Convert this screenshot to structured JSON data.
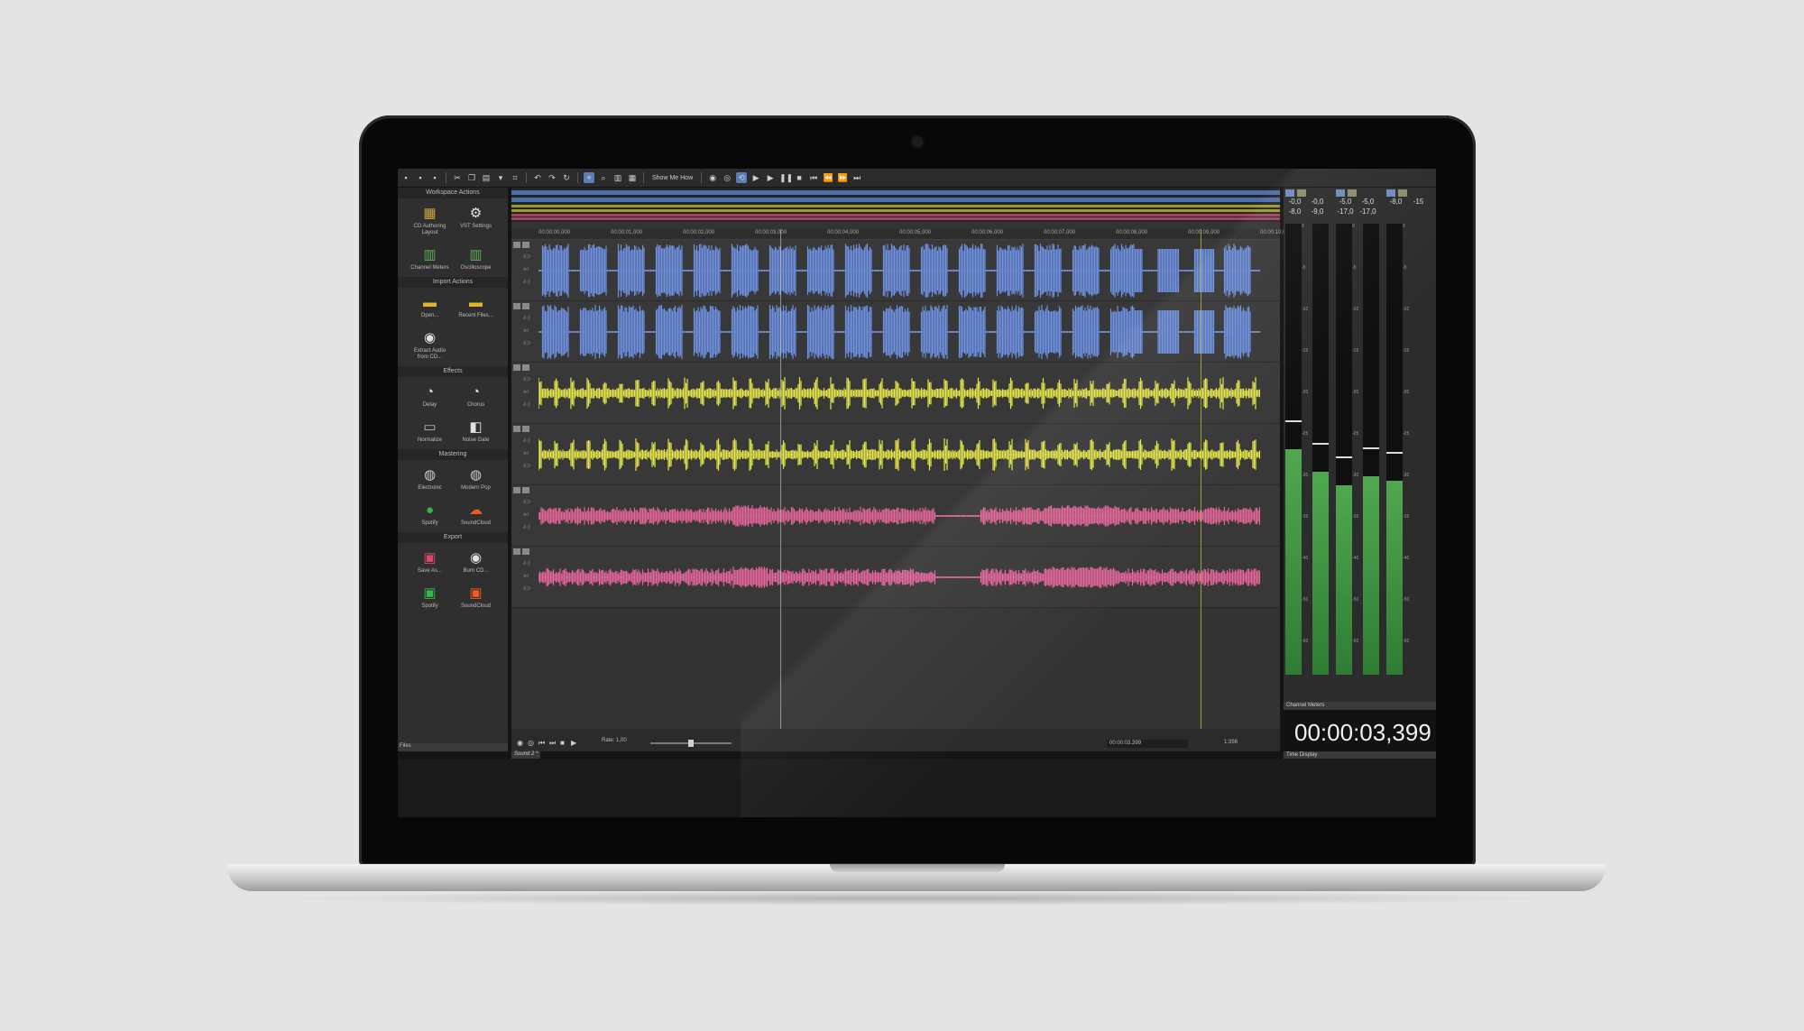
{
  "toolbar": {
    "show_me_how": "Show Me How"
  },
  "left_panel": {
    "sections": [
      {
        "title": "Workspace Actions",
        "items": [
          {
            "label": "CD Authoring Layout",
            "icon": "layout-grid-icon",
            "color": "#c9a53a"
          },
          {
            "label": "VST Settings",
            "icon": "gear-icon",
            "color": "#e8e8e8"
          },
          {
            "label": "Channel Meters",
            "icon": "channel-meters-icon",
            "color": "#5ab05a"
          },
          {
            "label": "Oscilloscope",
            "icon": "oscilloscope-icon",
            "color": "#5ab05a"
          }
        ]
      },
      {
        "title": "Import Actions",
        "items": [
          {
            "label": "Open...",
            "icon": "folder-icon",
            "color": "#e2b526"
          },
          {
            "label": "Recent Files...",
            "icon": "recent-files-icon",
            "color": "#e2b526"
          },
          {
            "label": "Extract Audio from CD...",
            "icon": "cd-icon",
            "color": "#e0e0e0"
          }
        ]
      },
      {
        "title": "Effects",
        "items": [
          {
            "label": "Delay",
            "icon": "delay-knob-icon",
            "color": "#e0e0e0"
          },
          {
            "label": "Chorus",
            "icon": "chorus-knob-icon",
            "color": "#e0e0e0"
          },
          {
            "label": "Normalize",
            "icon": "normalize-icon",
            "color": "#bdbdbd"
          },
          {
            "label": "Noise Gate",
            "icon": "noise-gate-icon",
            "color": "#e0e0e0"
          }
        ]
      },
      {
        "title": "Mastering",
        "items": [
          {
            "label": "Electronic",
            "icon": "electronic-preset-icon",
            "color": "#cfcfcf"
          },
          {
            "label": "Modern Pop",
            "icon": "modern-pop-preset-icon",
            "color": "#cfcfcf"
          },
          {
            "label": "Spotify",
            "icon": "spotify-icon",
            "color": "#39b54a"
          },
          {
            "label": "SoundCloud",
            "icon": "soundcloud-icon",
            "color": "#f05a22"
          }
        ]
      },
      {
        "title": "Export",
        "items": [
          {
            "label": "Save As...",
            "icon": "save-as-icon",
            "color": "#d94a6a"
          },
          {
            "label": "Burn CD...",
            "icon": "burn-cd-icon",
            "color": "#e0e0e0"
          },
          {
            "label": "Spotify",
            "icon": "spotify-export-icon",
            "color": "#39b54a"
          },
          {
            "label": "SoundCloud",
            "icon": "soundcloud-export-icon",
            "color": "#f05a22"
          }
        ]
      }
    ],
    "footer": "Files"
  },
  "ruler": {
    "ticks": [
      "00:00:00,000",
      "00:00:01,000",
      "00:00:02,000",
      "00:00:03,000",
      "00:00:04,000",
      "00:00:05,000",
      "00:00:06,000",
      "00:00:07,000",
      "00:00:08,000",
      "00:00:09,000",
      "00:00:10,0"
    ]
  },
  "tracks": {
    "scale_labels": [
      "-6,0",
      "-inf",
      "-6,0"
    ],
    "colors": [
      "#6f93e6",
      "#6f93e6",
      "#e7e84a",
      "#e7e84a",
      "#e8669b",
      "#e8669b"
    ]
  },
  "transport": {
    "rate_label": "Rate: 1,00",
    "rate_value": 1.0,
    "position": "00:00:03,399",
    "zoom": "1:356"
  },
  "document_tab": "Sound 2 *",
  "meters": {
    "groups": [
      {
        "values": [
          "-0,0",
          "-0,0",
          "-8,0",
          "-9,0"
        ],
        "levels": [
          0.5,
          0.45
        ]
      },
      {
        "values": [
          "-5,0",
          "-5,0",
          "-17,0",
          "-17,0"
        ],
        "levels": [
          0.42,
          0.44
        ]
      },
      {
        "values": [
          "-8,0",
          "-15"
        ],
        "levels": [
          0.43
        ]
      }
    ],
    "scale": [
      "0",
      "-5",
      "-10",
      "-15",
      "-20",
      "-25",
      "-30",
      "-35",
      "-40",
      "-50",
      "-60"
    ],
    "footer": "Channel Meters"
  },
  "time_display": {
    "value": "00:00:03,399",
    "footer": "Time Display"
  }
}
